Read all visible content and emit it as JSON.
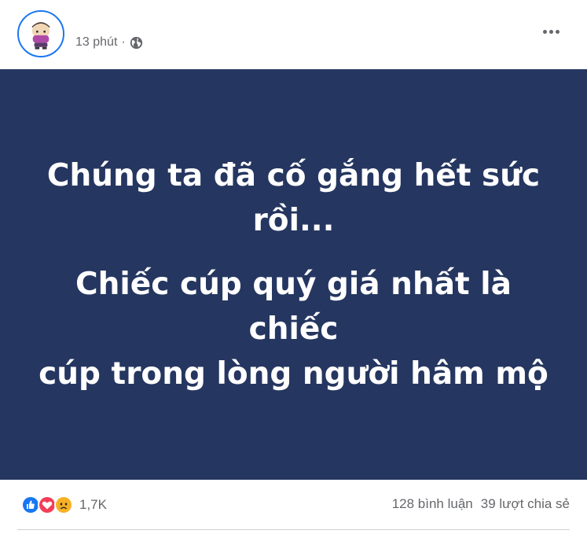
{
  "post": {
    "timestamp": "13 phút",
    "separator": "·",
    "privacy_icon": "globe-icon",
    "menu_icon": "more-horizontal-icon"
  },
  "image": {
    "background": "#253660",
    "line1": "Chúng ta đã cố gắng hết sức",
    "line2": "rồi...",
    "line3": "Chiếc cúp quý giá nhất là chiếc",
    "line4": "cúp trong lòng người hâm mộ"
  },
  "footer": {
    "reaction_icons": [
      "like-icon",
      "love-icon",
      "sad-icon"
    ],
    "reaction_count": "1,7K",
    "comments": "128 bình luận",
    "shares": "39 lượt chia sẻ"
  },
  "colors": {
    "accent": "#1877f2",
    "love": "#f33e58",
    "sad": "#f7b125",
    "muted": "#65676b"
  }
}
